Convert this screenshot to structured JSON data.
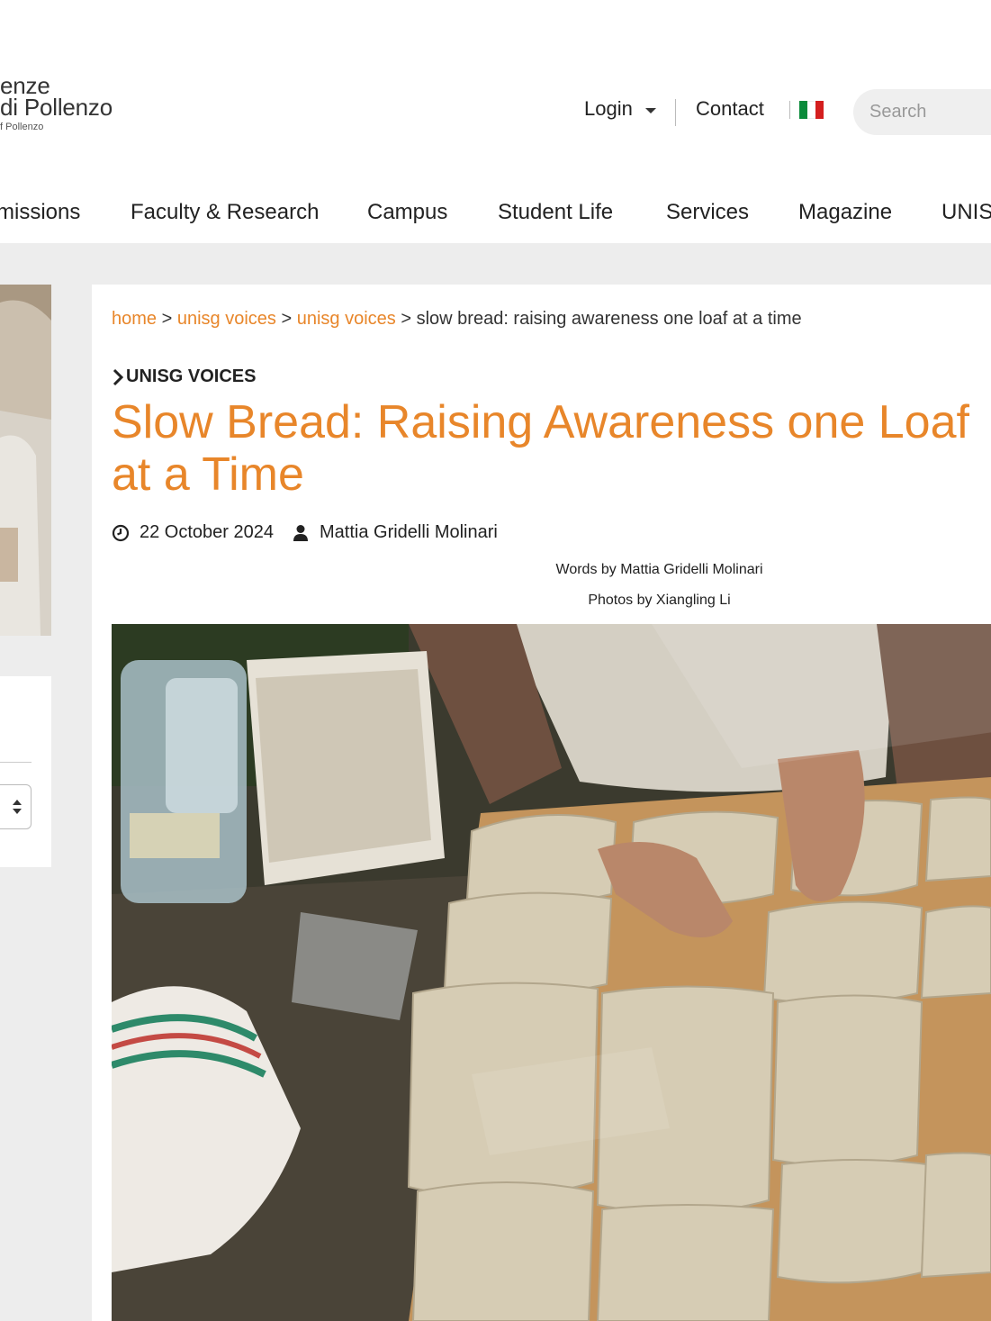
{
  "logo": {
    "line1": "enze",
    "line2": "di Pollenzo",
    "line3": "f Pollenzo"
  },
  "header": {
    "login_label": "Login",
    "contact_label": "Contact",
    "language_flag": "italian-flag",
    "search_placeholder": "Search"
  },
  "nav": {
    "items": [
      {
        "label": "missions"
      },
      {
        "label": "Faculty & Research"
      },
      {
        "label": "Campus"
      },
      {
        "label": "Student Life"
      },
      {
        "label": "Services"
      },
      {
        "label": "Magazine"
      },
      {
        "label": "UNIS"
      }
    ]
  },
  "breadcrumb": {
    "items": [
      {
        "label": "home"
      },
      {
        "label": "unisg voices"
      },
      {
        "label": "unisg voices"
      }
    ],
    "separator": ">",
    "current": "slow bread: raising awareness one loaf at a time"
  },
  "article": {
    "category": "UNISG VOICES",
    "title": "Slow Bread: Raising Awareness one Loaf at a Time",
    "date": "22 October 2024",
    "author": "Mattia Gridelli Molinari",
    "words_credit": "Words by Mattia Gridelli Molinari",
    "photos_credit": "Photos by Xiangling Li"
  },
  "colors": {
    "accent": "#e8862a",
    "background_grey": "#ededed",
    "text": "#222222"
  },
  "icons": {
    "clock": "clock-icon",
    "user": "user-icon",
    "chevron": "chevron-right-icon",
    "caret": "caret-down-icon"
  }
}
